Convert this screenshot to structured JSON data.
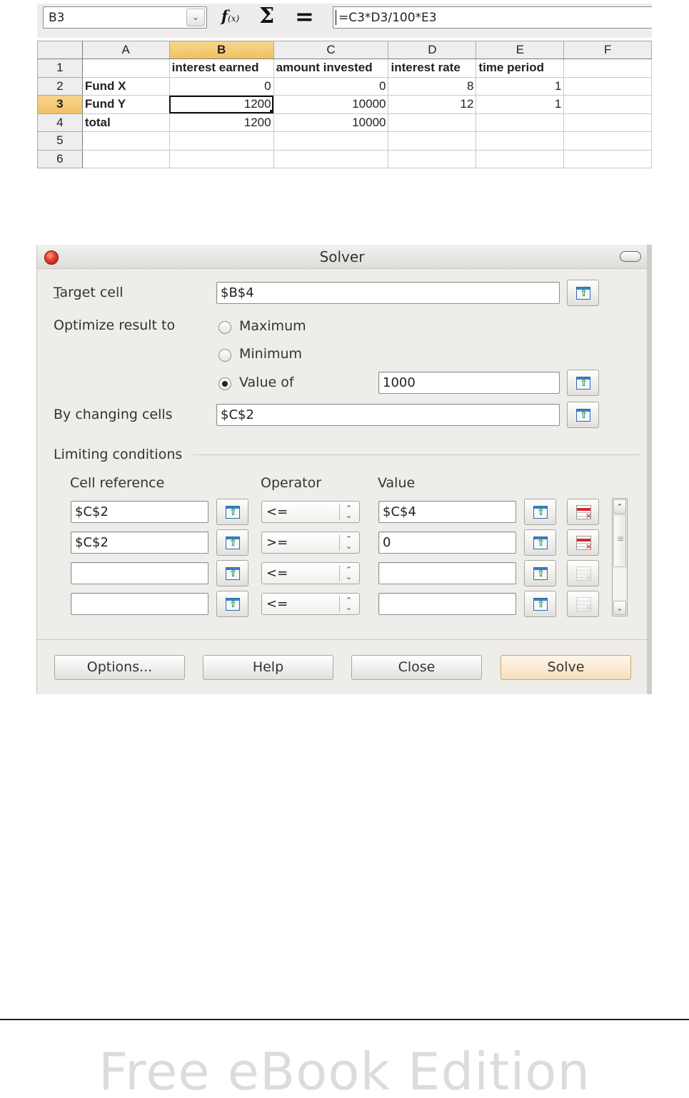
{
  "formula_bar": {
    "name_box": "B3",
    "function_wizard_label": "f(x)",
    "sum_label": "Σ",
    "function_label": "=",
    "formula": "=C3*D3/100*E3"
  },
  "sheet": {
    "columns": [
      "A",
      "B",
      "C",
      "D",
      "E",
      "F"
    ],
    "selected_column": "B",
    "selected_row": "3",
    "rows": [
      {
        "num": "1",
        "A": "",
        "B": "interest earned",
        "C": "amount invested",
        "D": "interest rate",
        "E": "time period",
        "F": ""
      },
      {
        "num": "2",
        "A": "Fund X",
        "B": "0",
        "C": "0",
        "D": "8",
        "E": "1",
        "F": ""
      },
      {
        "num": "3",
        "A": "Fund Y",
        "B": "1200",
        "C": "10000",
        "D": "12",
        "E": "1",
        "F": ""
      },
      {
        "num": "4",
        "A": "total",
        "B": "1200",
        "C": "10000",
        "D": "",
        "E": "",
        "F": ""
      },
      {
        "num": "5",
        "A": "",
        "B": "",
        "C": "",
        "D": "",
        "E": "",
        "F": ""
      },
      {
        "num": "6",
        "A": "",
        "B": "",
        "C": "",
        "D": "",
        "E": "",
        "F": ""
      }
    ]
  },
  "solver": {
    "title": "Solver",
    "target_cell_label": "Target cell",
    "target_cell_value": "$B$4",
    "optimize_label": "Optimize result to",
    "options": [
      {
        "label": "Maximum",
        "selected": false
      },
      {
        "label": "Minimum",
        "selected": false
      },
      {
        "label": "Value of",
        "selected": true
      }
    ],
    "value_of": "1000",
    "changing_cells_label": "By changing cells",
    "changing_cells_value": "$C$2",
    "limiting_conditions_label": "Limiting conditions",
    "col_cell_reference": "Cell reference",
    "col_operator": "Operator",
    "col_value": "Value",
    "conditions": [
      {
        "cell": "$C$2",
        "operator": "<=",
        "value": "$C$4"
      },
      {
        "cell": "$C$2",
        "operator": ">=",
        "value": "0"
      },
      {
        "cell": "",
        "operator": "<=",
        "value": ""
      },
      {
        "cell": "",
        "operator": "<=",
        "value": ""
      }
    ],
    "buttons": {
      "options": "Options...",
      "help": "Help",
      "close": "Close",
      "solve": "Solve"
    }
  },
  "footer": {
    "text": "Free eBook Edition"
  }
}
